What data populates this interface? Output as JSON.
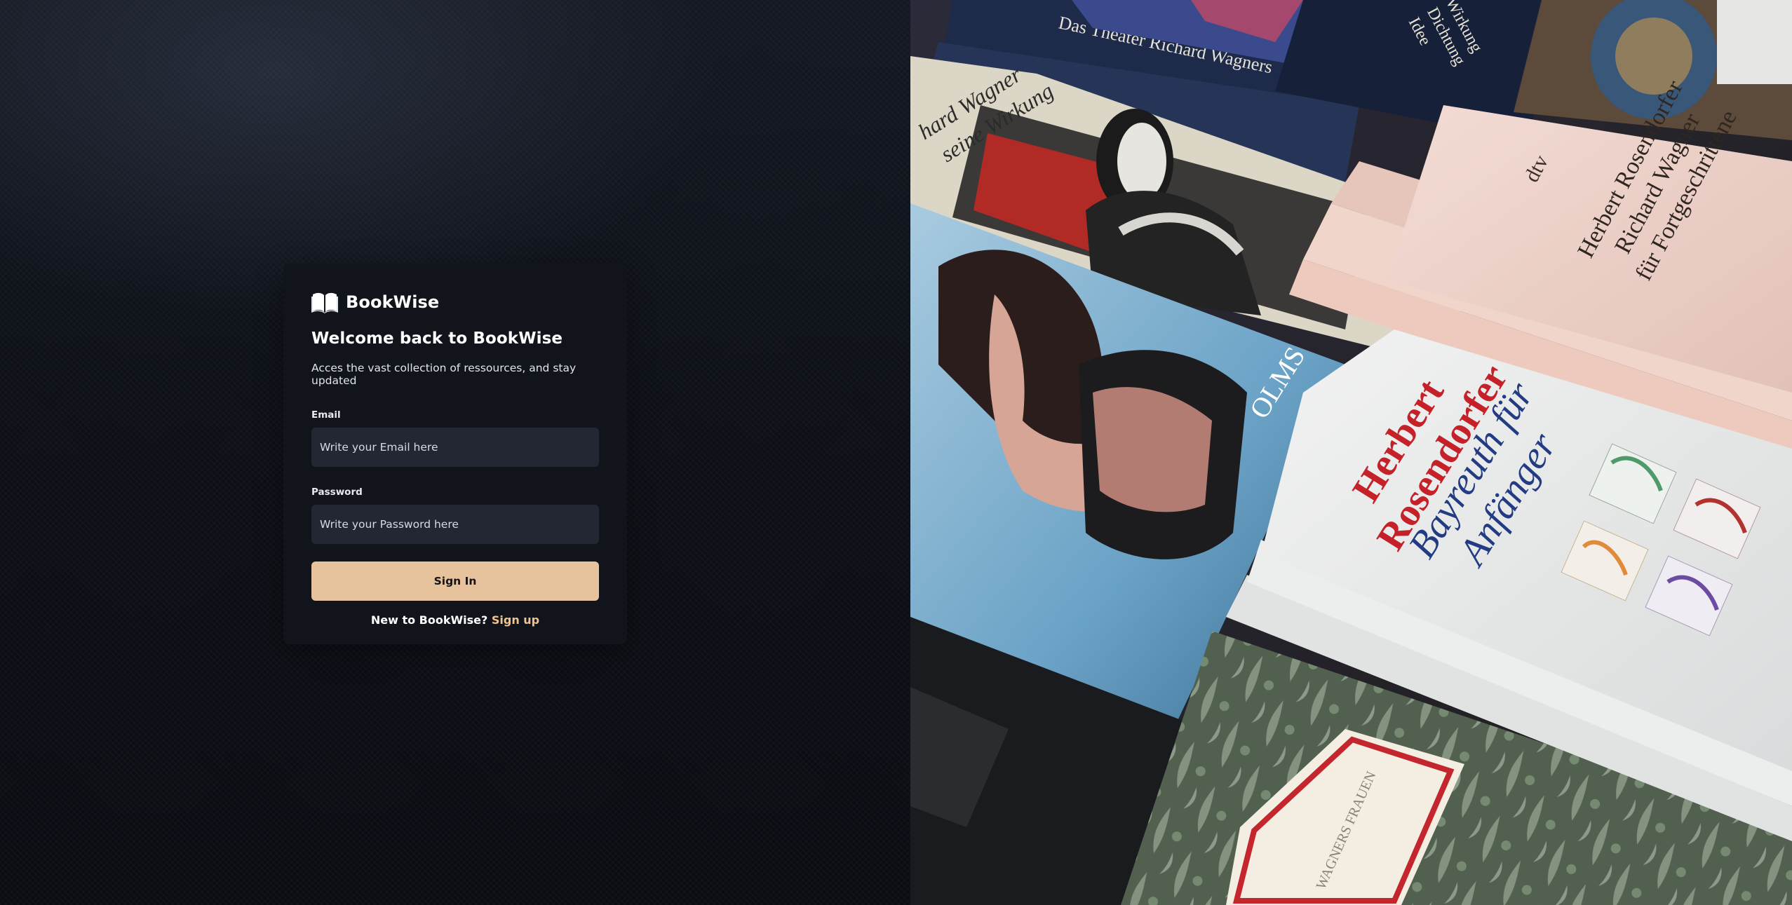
{
  "brand": {
    "name": "BookWise",
    "icon": "open-book-icon"
  },
  "auth": {
    "title": "Welcome back to BookWise",
    "subtitle": "Acces the vast collection of ressources, and stay updated",
    "email": {
      "label": "Email",
      "placeholder": "Write your Email here",
      "value": ""
    },
    "password": {
      "label": "Password",
      "placeholder": "Write your Password here",
      "value": ""
    },
    "submit_label": "Sign In",
    "footer": {
      "question": "New to BookWise?",
      "link_label": "Sign up"
    }
  },
  "illustration": {
    "books": [
      {
        "lines": [
          "Herbert",
          "Rosendorfer"
        ]
      },
      {
        "lines": [
          "Bayreuth für",
          "Anfänger"
        ]
      },
      {
        "lines": [
          "Herbert Rosendorfer",
          "Richard Wagner",
          "für Fortgeschrittene"
        ]
      },
      {
        "lines": [
          "dtv"
        ]
      },
      {
        "lines": [
          "OLMS"
        ]
      },
      {
        "lines": [
          "Das Theater Richard Wagners"
        ]
      },
      {
        "lines": [
          "Idee",
          "Dichtung",
          "Wirkung"
        ]
      },
      {
        "lines": [
          "hard Wagner",
          "seine Wirkung"
        ]
      },
      {
        "lines": [
          "WAGNERS FRAUEN"
        ]
      }
    ]
  },
  "colors": {
    "accent": "#e6c39c",
    "link": "#f0c48e",
    "card": "#12141c",
    "input": "#232734"
  }
}
